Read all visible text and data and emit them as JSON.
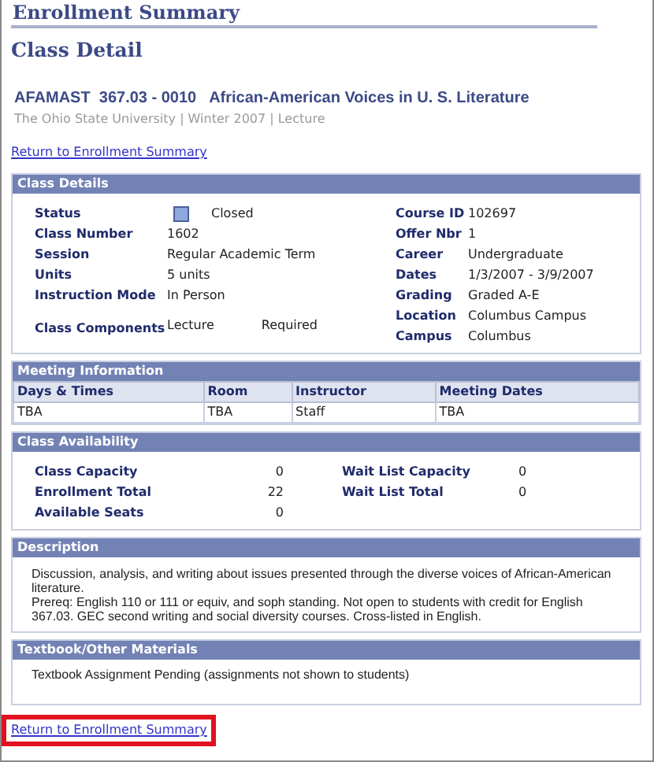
{
  "page_title": "Enrollment Summary",
  "heading": "Class Detail",
  "course_title": "AFAMAST  367.03 - 0010   African-American Voices in U. S. Literature",
  "course_subtitle": "The Ohio State University | Winter 2007 | Lecture",
  "top_link": {
    "label": "Return to Enrollment Summary",
    "highlighted": false
  },
  "class_details": {
    "title": "Class Details",
    "left": [
      {
        "kind": "status",
        "label": "Status",
        "value": "Closed"
      },
      {
        "kind": "text",
        "label": "Class Number",
        "value": "1602"
      },
      {
        "kind": "text",
        "label": "Session",
        "value": "Regular Academic Term"
      },
      {
        "kind": "text",
        "label": "Units",
        "value": "5 units"
      },
      {
        "kind": "text",
        "label": "Instruction Mode",
        "value": "In Person"
      },
      {
        "kind": "components",
        "label": "Class Components",
        "values": [
          "Lecture",
          "Required"
        ]
      }
    ],
    "right": [
      {
        "label": "Course ID",
        "value": "102697"
      },
      {
        "label": "Offer Nbr",
        "value": "1"
      },
      {
        "label": "Career",
        "value": "Undergraduate"
      },
      {
        "label": "Dates",
        "value": "1/3/2007 - 3/9/2007"
      },
      {
        "label": "Grading",
        "value": "Graded A-E"
      },
      {
        "label": "Location",
        "value": "Columbus Campus"
      },
      {
        "label": "Campus",
        "value": "Columbus"
      }
    ]
  },
  "meeting_information": {
    "title": "Meeting Information",
    "columns": [
      "Days & Times",
      "Room",
      "Instructor",
      "Meeting Dates"
    ],
    "rows": [
      [
        "TBA",
        "TBA",
        "Staff",
        "TBA"
      ]
    ]
  },
  "class_availability": {
    "title": "Class Availability",
    "left": [
      {
        "label": "Class Capacity",
        "value": "0"
      },
      {
        "label": "Enrollment Total",
        "value": "22"
      },
      {
        "label": "Available Seats",
        "value": "0"
      }
    ],
    "right": [
      {
        "label": "Wait List Capacity",
        "value": "0"
      },
      {
        "label": "Wait List Total",
        "value": "0"
      }
    ]
  },
  "description": {
    "title": "Description",
    "paragraphs": [
      "Discussion, analysis, and writing about issues presented through the diverse voices of African-American literature.",
      "Prereq: English 110 or 111 or equiv, and soph standing. Not open to students with credit for English 367.03. GEC second writing and social diversity courses. Cross-listed in English."
    ]
  },
  "textbook": {
    "title": "Textbook/Other Materials",
    "text": "Textbook Assignment Pending  (assignments not shown to students)"
  },
  "bottom_link": {
    "label": "Return to Enrollment Summary",
    "highlighted": true
  }
}
